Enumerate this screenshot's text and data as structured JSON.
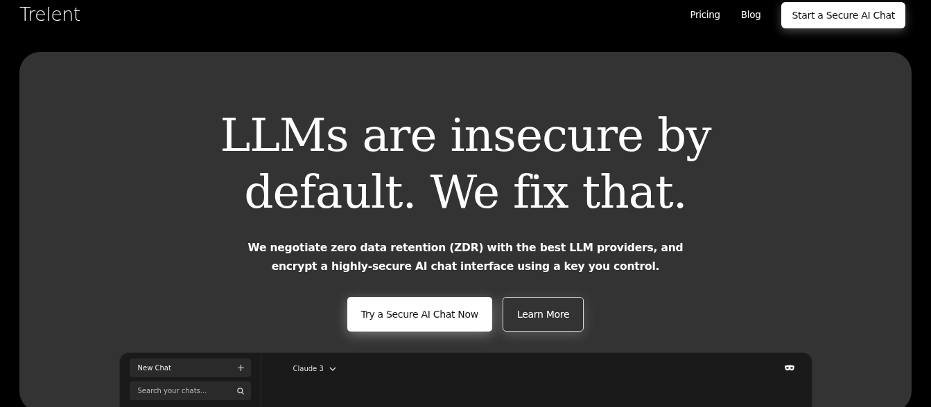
{
  "header": {
    "logo": "Trelent",
    "nav": [
      "Pricing",
      "Blog"
    ],
    "cta": "Start a Secure AI Chat"
  },
  "hero": {
    "title_lines": [
      "LLMs are insecure by",
      "default. We fix that."
    ],
    "subtitle_lines": [
      "We negotiate zero data retention (ZDR) with the best LLM providers, and",
      "encrypt a highly-secure AI chat interface using a key you control."
    ],
    "buttons": [
      {
        "label": "Try a Secure AI Chat Now",
        "kind": "primary"
      },
      {
        "label": "Learn More",
        "kind": "outline"
      }
    ]
  },
  "app": {
    "new_chat": "New Chat",
    "search": {
      "placeholder": "Search your chats..."
    },
    "model": "Claude 3"
  }
}
